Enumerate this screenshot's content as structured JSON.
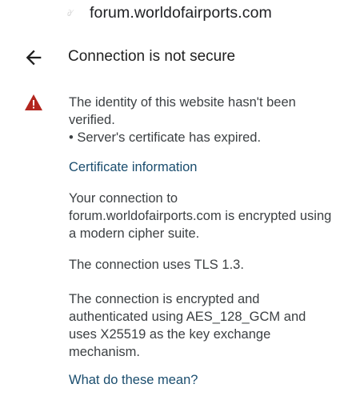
{
  "url_bar": {
    "domain": "forum.worldofairports.com"
  },
  "dialog": {
    "title": "Connection is not secure",
    "identity_warning": "The identity of this website hasn't been verified.",
    "certificate_issue": "• Server's certificate has expired.",
    "certificate_link": "Certificate information",
    "encryption_info": "Your connection to forum.worldofairports.com is encrypted using a modern cipher suite.",
    "tls_info": "The connection uses TLS 1.3.",
    "cipher_info": "The connection is encrypted and authenticated using AES_128_GCM and uses X25519 as the key exchange mechanism.",
    "help_link": "What do these mean?"
  },
  "icons": {
    "back": "arrow-back-icon",
    "warning": "warning-triangle-icon",
    "warning_color": "#b3261e"
  }
}
